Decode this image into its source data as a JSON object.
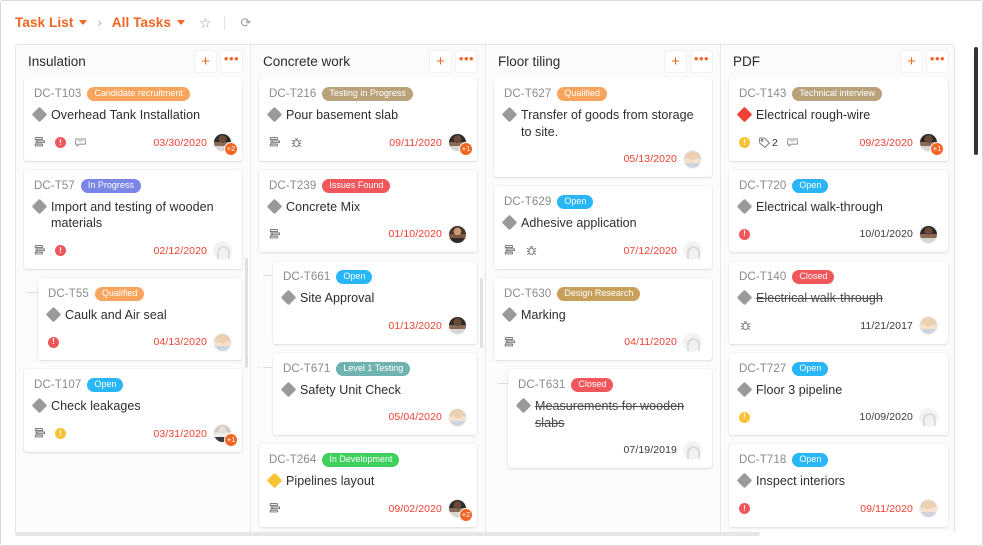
{
  "breadcrumb": {
    "items": [
      {
        "label": "Task List",
        "has_caret": true
      },
      {
        "label": "All Tasks",
        "has_caret": true
      }
    ],
    "separator": "›",
    "star_icon": "☆",
    "refresh_icon": "⟳"
  },
  "colors": {
    "accent": "#f26522",
    "due_overdue": "#f04134",
    "due_normal": "#3a3a3a",
    "badge_qualified": "#f9a45c",
    "badge_open": "#29b6f6",
    "badge_in_progress": "#7986e8",
    "badge_issues_found": "#f0565a",
    "badge_closed": "#f0565a",
    "badge_testing_in_progress": "#b9a17a",
    "badge_design_research": "#c8a05c",
    "badge_technical_interview": "#b9a17a",
    "badge_level_1_testing": "#6fb3ae",
    "badge_candidate_recruitment": "#f9a45c",
    "badge_in_development": "#3ecf5c"
  },
  "columns": [
    {
      "title": "Insulation",
      "add_label": "+",
      "more_label": "•••",
      "cards": [
        {
          "id": "DC-T103",
          "badge": {
            "label": "Candidate recruitment",
            "color": "#f9a45c"
          },
          "title": "Overhead Tank Installation",
          "severity": "grey",
          "strike": false,
          "indent": false,
          "icons": [
            "subtask-icon",
            "priority-red",
            "comment-icon"
          ],
          "priority": "red",
          "tag_count": null,
          "due": "03/30/2020",
          "due_overdue": true,
          "avatar": {
            "type": "photo",
            "tone": "dark",
            "extra": "+2"
          }
        },
        {
          "id": "DC-T57",
          "badge": {
            "label": "In Progress",
            "color": "#7986e8"
          },
          "title": "Import and testing of wooden materials",
          "severity": "grey",
          "strike": false,
          "indent": false,
          "icons": [
            "subtask-icon",
            "priority-red"
          ],
          "priority": "red",
          "tag_count": null,
          "due": "02/12/2020",
          "due_overdue": true,
          "avatar": {
            "type": "empty",
            "tone": "",
            "extra": null
          }
        },
        {
          "id": "DC-T55",
          "badge": {
            "label": "Qualified",
            "color": "#f9a45c"
          },
          "title": "Caulk and Air seal",
          "severity": "grey",
          "strike": false,
          "indent": true,
          "icons": [
            "priority-red"
          ],
          "priority": "red",
          "tag_count": null,
          "due": "04/13/2020",
          "due_overdue": true,
          "avatar": {
            "type": "photo",
            "tone": "light",
            "extra": null
          }
        },
        {
          "id": "DC-T107",
          "badge": {
            "label": "Open",
            "color": "#29b6f6"
          },
          "title": "Check leakages",
          "severity": "grey",
          "strike": false,
          "indent": false,
          "icons": [
            "subtask-icon",
            "priority-yellow"
          ],
          "priority": "yellow",
          "tag_count": null,
          "due": "03/31/2020",
          "due_overdue": true,
          "avatar": {
            "type": "photo",
            "tone": "grey",
            "extra": "+1"
          }
        }
      ]
    },
    {
      "title": "Concrete work",
      "add_label": "+",
      "more_label": "•••",
      "cards": [
        {
          "id": "DC-T216",
          "badge": {
            "label": "Testing in Progress",
            "color": "#b9a17a"
          },
          "title": "Pour basement slab",
          "severity": "grey",
          "strike": false,
          "indent": false,
          "icons": [
            "subtask-icon",
            "bug-icon"
          ],
          "priority": null,
          "tag_count": null,
          "due": "09/11/2020",
          "due_overdue": true,
          "avatar": {
            "type": "photo",
            "tone": "dark",
            "extra": "+1"
          }
        },
        {
          "id": "DC-T239",
          "badge": {
            "label": "Issues Found",
            "color": "#f0565a"
          },
          "title": "Concrete Mix",
          "severity": "grey",
          "strike": false,
          "indent": false,
          "icons": [
            "subtask-icon"
          ],
          "priority": null,
          "tag_count": null,
          "due": "01/10/2020",
          "due_overdue": true,
          "avatar": {
            "type": "photo",
            "tone": "brown",
            "extra": null
          }
        },
        {
          "id": "DC-T661",
          "badge": {
            "label": "Open",
            "color": "#29b6f6"
          },
          "title": "Site Approval",
          "severity": "grey",
          "strike": false,
          "indent": true,
          "icons": [],
          "priority": null,
          "tag_count": null,
          "due": "01/13/2020",
          "due_overdue": true,
          "avatar": {
            "type": "photo",
            "tone": "dark",
            "extra": null
          }
        },
        {
          "id": "DC-T671",
          "badge": {
            "label": "Level 1 Testing",
            "color": "#6fb3ae"
          },
          "title": "Safety Unit Check",
          "severity": "grey",
          "strike": false,
          "indent": true,
          "icons": [],
          "priority": null,
          "tag_count": null,
          "due": "05/04/2020",
          "due_overdue": true,
          "avatar": {
            "type": "photo",
            "tone": "light",
            "extra": null
          }
        },
        {
          "id": "DC-T264",
          "badge": {
            "label": "In Development",
            "color": "#3ecf5c"
          },
          "title": "Pipelines layout",
          "severity": "yellow",
          "strike": false,
          "indent": false,
          "icons": [
            "subtask-icon"
          ],
          "priority": null,
          "tag_count": null,
          "due": "09/02/2020",
          "due_overdue": true,
          "avatar": {
            "type": "photo",
            "tone": "dark",
            "extra": "+2"
          }
        }
      ]
    },
    {
      "title": "Floor tiling",
      "add_label": "+",
      "more_label": "•••",
      "cards": [
        {
          "id": "DC-T627",
          "badge": {
            "label": "Qualified",
            "color": "#f9a45c"
          },
          "title": "Transfer of goods from storage to site.",
          "severity": "grey",
          "strike": false,
          "indent": false,
          "icons": [],
          "priority": null,
          "tag_count": null,
          "due": "05/13/2020",
          "due_overdue": true,
          "avatar": {
            "type": "photo",
            "tone": "light",
            "extra": null
          }
        },
        {
          "id": "DC-T629",
          "badge": {
            "label": "Open",
            "color": "#29b6f6"
          },
          "title": "Adhesive application",
          "severity": "grey",
          "strike": false,
          "indent": false,
          "icons": [
            "subtask-icon",
            "bug-icon"
          ],
          "priority": null,
          "tag_count": null,
          "due": "07/12/2020",
          "due_overdue": true,
          "avatar": {
            "type": "empty",
            "tone": "",
            "extra": null
          }
        },
        {
          "id": "DC-T630",
          "badge": {
            "label": "Design Research",
            "color": "#c8a05c"
          },
          "title": "Marking",
          "severity": "grey",
          "strike": false,
          "indent": false,
          "icons": [
            "subtask-icon"
          ],
          "priority": null,
          "tag_count": null,
          "due": "04/11/2020",
          "due_overdue": true,
          "avatar": {
            "type": "empty",
            "tone": "",
            "extra": null
          }
        },
        {
          "id": "DC-T631",
          "badge": {
            "label": "Closed",
            "color": "#f0565a"
          },
          "title": "Measurements for wooden slabs",
          "severity": "grey",
          "strike": true,
          "indent": true,
          "icons": [],
          "priority": null,
          "tag_count": null,
          "due": "07/19/2019",
          "due_overdue": false,
          "avatar": {
            "type": "empty",
            "tone": "",
            "extra": null
          }
        }
      ]
    },
    {
      "title": "PDF",
      "add_label": "+",
      "more_label": "•••",
      "cards": [
        {
          "id": "DC-T143",
          "badge": {
            "label": "Technical interview",
            "color": "#b9a17a"
          },
          "title": "Electrical rough-wire",
          "severity": "red",
          "strike": false,
          "indent": false,
          "icons": [
            "priority-yellow",
            "tag-icon",
            "comment-icon"
          ],
          "priority": "yellow",
          "tag_count": "2",
          "due": "09/23/2020",
          "due_overdue": true,
          "avatar": {
            "type": "photo",
            "tone": "dark",
            "extra": "+1"
          }
        },
        {
          "id": "DC-T720",
          "badge": {
            "label": "Open",
            "color": "#29b6f6"
          },
          "title": "Electrical walk-through",
          "severity": "grey",
          "strike": false,
          "indent": false,
          "icons": [
            "priority-red"
          ],
          "priority": "red",
          "tag_count": null,
          "due": "10/01/2020",
          "due_overdue": false,
          "avatar": {
            "type": "photo",
            "tone": "dark",
            "extra": null
          }
        },
        {
          "id": "DC-T140",
          "badge": {
            "label": "Closed",
            "color": "#f0565a"
          },
          "title": "Electrical walk-through",
          "severity": "grey",
          "strike": true,
          "indent": false,
          "icons": [
            "bug-icon"
          ],
          "priority": null,
          "tag_count": null,
          "due": "11/21/2017",
          "due_overdue": false,
          "avatar": {
            "type": "photo",
            "tone": "light",
            "extra": null
          }
        },
        {
          "id": "DC-T727",
          "badge": {
            "label": "Open",
            "color": "#29b6f6"
          },
          "title": "Floor 3 pipeline",
          "severity": "grey",
          "strike": false,
          "indent": false,
          "icons": [
            "priority-yellow"
          ],
          "priority": "yellow",
          "tag_count": null,
          "due": "10/09/2020",
          "due_overdue": false,
          "avatar": {
            "type": "empty",
            "tone": "",
            "extra": null
          }
        },
        {
          "id": "DC-T718",
          "badge": {
            "label": "Open",
            "color": "#29b6f6"
          },
          "title": "Inspect interiors",
          "severity": "grey",
          "strike": false,
          "indent": false,
          "icons": [
            "priority-red"
          ],
          "priority": "red",
          "tag_count": null,
          "due": "09/11/2020",
          "due_overdue": true,
          "avatar": {
            "type": "photo",
            "tone": "light",
            "extra": null
          }
        }
      ]
    }
  ]
}
